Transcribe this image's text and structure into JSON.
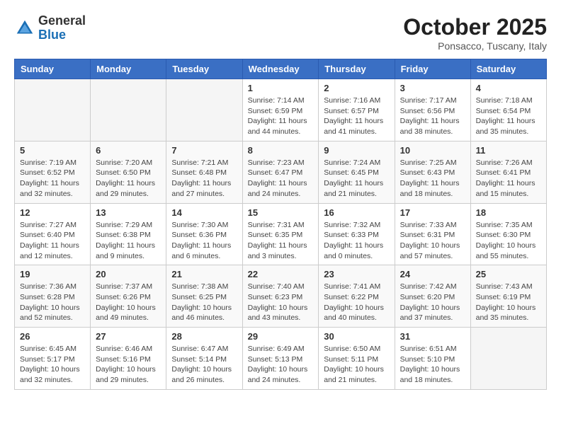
{
  "header": {
    "logo_general": "General",
    "logo_blue": "Blue",
    "month": "October 2025",
    "location": "Ponsacco, Tuscany, Italy"
  },
  "weekdays": [
    "Sunday",
    "Monday",
    "Tuesday",
    "Wednesday",
    "Thursday",
    "Friday",
    "Saturday"
  ],
  "weeks": [
    [
      {
        "day": "",
        "info": ""
      },
      {
        "day": "",
        "info": ""
      },
      {
        "day": "",
        "info": ""
      },
      {
        "day": "1",
        "info": "Sunrise: 7:14 AM\nSunset: 6:59 PM\nDaylight: 11 hours\nand 44 minutes."
      },
      {
        "day": "2",
        "info": "Sunrise: 7:16 AM\nSunset: 6:57 PM\nDaylight: 11 hours\nand 41 minutes."
      },
      {
        "day": "3",
        "info": "Sunrise: 7:17 AM\nSunset: 6:56 PM\nDaylight: 11 hours\nand 38 minutes."
      },
      {
        "day": "4",
        "info": "Sunrise: 7:18 AM\nSunset: 6:54 PM\nDaylight: 11 hours\nand 35 minutes."
      }
    ],
    [
      {
        "day": "5",
        "info": "Sunrise: 7:19 AM\nSunset: 6:52 PM\nDaylight: 11 hours\nand 32 minutes."
      },
      {
        "day": "6",
        "info": "Sunrise: 7:20 AM\nSunset: 6:50 PM\nDaylight: 11 hours\nand 29 minutes."
      },
      {
        "day": "7",
        "info": "Sunrise: 7:21 AM\nSunset: 6:48 PM\nDaylight: 11 hours\nand 27 minutes."
      },
      {
        "day": "8",
        "info": "Sunrise: 7:23 AM\nSunset: 6:47 PM\nDaylight: 11 hours\nand 24 minutes."
      },
      {
        "day": "9",
        "info": "Sunrise: 7:24 AM\nSunset: 6:45 PM\nDaylight: 11 hours\nand 21 minutes."
      },
      {
        "day": "10",
        "info": "Sunrise: 7:25 AM\nSunset: 6:43 PM\nDaylight: 11 hours\nand 18 minutes."
      },
      {
        "day": "11",
        "info": "Sunrise: 7:26 AM\nSunset: 6:41 PM\nDaylight: 11 hours\nand 15 minutes."
      }
    ],
    [
      {
        "day": "12",
        "info": "Sunrise: 7:27 AM\nSunset: 6:40 PM\nDaylight: 11 hours\nand 12 minutes."
      },
      {
        "day": "13",
        "info": "Sunrise: 7:29 AM\nSunset: 6:38 PM\nDaylight: 11 hours\nand 9 minutes."
      },
      {
        "day": "14",
        "info": "Sunrise: 7:30 AM\nSunset: 6:36 PM\nDaylight: 11 hours\nand 6 minutes."
      },
      {
        "day": "15",
        "info": "Sunrise: 7:31 AM\nSunset: 6:35 PM\nDaylight: 11 hours\nand 3 minutes."
      },
      {
        "day": "16",
        "info": "Sunrise: 7:32 AM\nSunset: 6:33 PM\nDaylight: 11 hours\nand 0 minutes."
      },
      {
        "day": "17",
        "info": "Sunrise: 7:33 AM\nSunset: 6:31 PM\nDaylight: 10 hours\nand 57 minutes."
      },
      {
        "day": "18",
        "info": "Sunrise: 7:35 AM\nSunset: 6:30 PM\nDaylight: 10 hours\nand 55 minutes."
      }
    ],
    [
      {
        "day": "19",
        "info": "Sunrise: 7:36 AM\nSunset: 6:28 PM\nDaylight: 10 hours\nand 52 minutes."
      },
      {
        "day": "20",
        "info": "Sunrise: 7:37 AM\nSunset: 6:26 PM\nDaylight: 10 hours\nand 49 minutes."
      },
      {
        "day": "21",
        "info": "Sunrise: 7:38 AM\nSunset: 6:25 PM\nDaylight: 10 hours\nand 46 minutes."
      },
      {
        "day": "22",
        "info": "Sunrise: 7:40 AM\nSunset: 6:23 PM\nDaylight: 10 hours\nand 43 minutes."
      },
      {
        "day": "23",
        "info": "Sunrise: 7:41 AM\nSunset: 6:22 PM\nDaylight: 10 hours\nand 40 minutes."
      },
      {
        "day": "24",
        "info": "Sunrise: 7:42 AM\nSunset: 6:20 PM\nDaylight: 10 hours\nand 37 minutes."
      },
      {
        "day": "25",
        "info": "Sunrise: 7:43 AM\nSunset: 6:19 PM\nDaylight: 10 hours\nand 35 minutes."
      }
    ],
    [
      {
        "day": "26",
        "info": "Sunrise: 6:45 AM\nSunset: 5:17 PM\nDaylight: 10 hours\nand 32 minutes."
      },
      {
        "day": "27",
        "info": "Sunrise: 6:46 AM\nSunset: 5:16 PM\nDaylight: 10 hours\nand 29 minutes."
      },
      {
        "day": "28",
        "info": "Sunrise: 6:47 AM\nSunset: 5:14 PM\nDaylight: 10 hours\nand 26 minutes."
      },
      {
        "day": "29",
        "info": "Sunrise: 6:49 AM\nSunset: 5:13 PM\nDaylight: 10 hours\nand 24 minutes."
      },
      {
        "day": "30",
        "info": "Sunrise: 6:50 AM\nSunset: 5:11 PM\nDaylight: 10 hours\nand 21 minutes."
      },
      {
        "day": "31",
        "info": "Sunrise: 6:51 AM\nSunset: 5:10 PM\nDaylight: 10 hours\nand 18 minutes."
      },
      {
        "day": "",
        "info": ""
      }
    ]
  ]
}
